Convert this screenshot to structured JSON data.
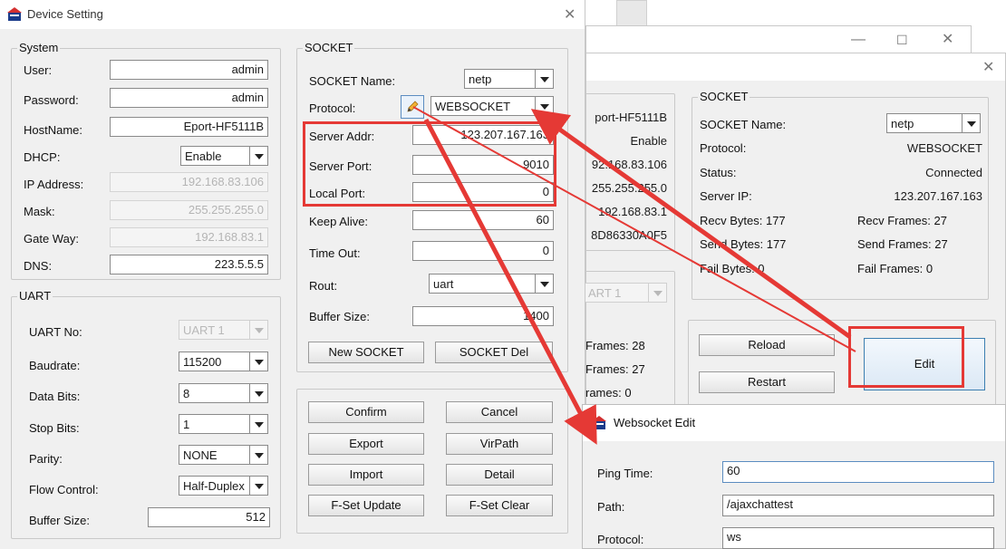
{
  "main": {
    "title": "Device Setting",
    "system": {
      "title": "System",
      "user_label": "User:",
      "user": "admin",
      "password_label": "Password:",
      "password": "admin",
      "hostname_label": "HostName:",
      "hostname": "Eport-HF5111B",
      "dhcp_label": "DHCP:",
      "dhcp": "Enable",
      "ip_label": "IP Address:",
      "ip": "192.168.83.106",
      "mask_label": "Mask:",
      "mask": "255.255.255.0",
      "gateway_label": "Gate Way:",
      "gateway": "192.168.83.1",
      "dns_label": "DNS:",
      "dns": "223.5.5.5"
    },
    "uart": {
      "title": "UART",
      "uart_no_label": "UART No:",
      "uart_no": "UART 1",
      "baudrate_label": "Baudrate:",
      "baudrate": "115200",
      "databits_label": "Data Bits:",
      "databits": "8",
      "stopbits_label": "Stop Bits:",
      "stopbits": "1",
      "parity_label": "Parity:",
      "parity": "NONE",
      "flow_label": "Flow Control:",
      "flow": "Half-Duplex",
      "buffer_label": "Buffer Size:",
      "buffer": "512"
    },
    "socket": {
      "title": "SOCKET",
      "name_label": "SOCKET Name:",
      "name": "netp",
      "protocol_label": "Protocol:",
      "protocol": "WEBSOCKET",
      "server_addr_label": "Server Addr:",
      "server_addr": "123.207.167.163",
      "server_port_label": "Server Port:",
      "server_port": "9010",
      "local_port_label": "Local Port:",
      "local_port": "0",
      "keepalive_label": "Keep Alive:",
      "keepalive": "60",
      "timeout_label": "Time Out:",
      "timeout": "0",
      "rout_label": "Rout:",
      "rout": "uart",
      "buffer_label": "Buffer Size:",
      "buffer": "1400",
      "new_btn": "New SOCKET",
      "del_btn": "SOCKET Del"
    },
    "buttons": {
      "confirm": "Confirm",
      "cancel": "Cancel",
      "export": "Export",
      "virpath": "VirPath",
      "import": "Import",
      "detail": "Detail",
      "fset_update": "F-Set Update",
      "fset_clear": "F-Set Clear"
    }
  },
  "status": {
    "left_partial": {
      "hostname": "port-HF5111B",
      "dhcp": "Enable",
      "ip": "92.168.83.106",
      "mask": "255.255.255.0",
      "gateway": "192.168.83.1",
      "mac": "8D86330A0F5",
      "uart": "ART 1",
      "frames1": "Frames: 28",
      "frames2": "Frames: 27",
      "frames3": "rames: 0"
    },
    "socket": {
      "title": "SOCKET",
      "name_label": "SOCKET Name:",
      "name": "netp",
      "protocol_label": "Protocol:",
      "protocol": "WEBSOCKET",
      "status_label": "Status:",
      "status": "Connected",
      "server_ip_label": "Server IP:",
      "server_ip": "123.207.167.163",
      "recv_bytes": "Recv Bytes: 177",
      "recv_frames": "Recv Frames: 27",
      "send_bytes": "Send Bytes: 177",
      "send_frames": "Send Frames: 27",
      "fail_bytes": "Fail Bytes: 0",
      "fail_frames": "Fail Frames: 0"
    },
    "reload_btn": "Reload",
    "restart_btn": "Restart",
    "edit_btn": "Edit"
  },
  "ws_edit": {
    "title": "Websocket Edit",
    "ping_label": "Ping Time:",
    "ping": "60",
    "path_label": "Path:",
    "path": "/ajaxchattest",
    "protocol_label": "Protocol:",
    "protocol": "ws"
  },
  "colors": {
    "highlight": "#e53935",
    "accent_border": "#3c7fb1"
  },
  "icons": [
    "app-icon",
    "close-icon",
    "minimize-icon",
    "maximize-icon",
    "pencil-edit-icon",
    "chevron-down-icon"
  ]
}
